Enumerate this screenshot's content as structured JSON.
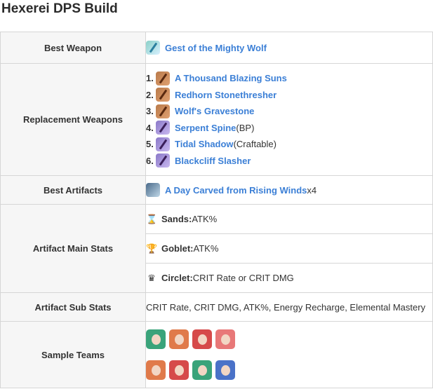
{
  "title": "Hexerei DPS Build",
  "rows": {
    "best_weapon": {
      "label": "Best Weapon",
      "name": "Gest of the Mighty Wolf",
      "icon": "sword-icon"
    },
    "replacement": {
      "label": "Replacement Weapons",
      "items": [
        {
          "num": "1.",
          "name": "A Thousand Blazing Suns",
          "note": "",
          "icon": "claymore-icon"
        },
        {
          "num": "2.",
          "name": "Redhorn Stonethresher",
          "note": "",
          "icon": "claymore-icon"
        },
        {
          "num": "3.",
          "name": "Wolf's Gravestone",
          "note": "",
          "icon": "claymore-icon"
        },
        {
          "num": "4.",
          "name": "Serpent Spine",
          "note": " (BP)",
          "icon": "claymore-icon"
        },
        {
          "num": "5.",
          "name": "Tidal Shadow",
          "note": " (Craftable)",
          "icon": "claymore-icon"
        },
        {
          "num": "6.",
          "name": "Blackcliff Slasher",
          "note": "",
          "icon": "claymore-icon"
        }
      ]
    },
    "best_artifacts": {
      "label": "Best Artifacts",
      "name": "A Day Carved from Rising Winds",
      "suffix": " x4",
      "icon": "artifact-icon"
    },
    "main_stats": {
      "label": "Artifact Main Stats",
      "sands_label": "Sands:",
      "sands_value": " ATK%",
      "goblet_label": "Goblet:",
      "goblet_value": " ATK%",
      "circlet_label": "Circlet:",
      "circlet_value": " CRIT Rate or CRIT DMG"
    },
    "sub_stats": {
      "label": "Artifact Sub Stats",
      "value": "CRIT Rate, CRIT DMG, ATK%, Energy Recharge, Elemental Mastery"
    },
    "teams": {
      "label": "Sample Teams"
    }
  }
}
